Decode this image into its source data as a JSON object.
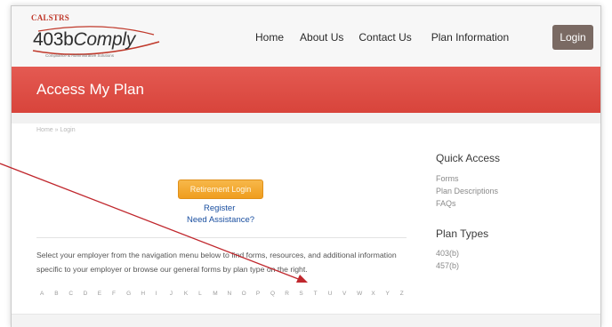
{
  "logo": {
    "top_text": "CALSTRS",
    "main_text_a": "403b",
    "main_text_b": "Comply",
    "tagline": "Compliance & Administrative Solutions"
  },
  "nav": {
    "items": [
      "Home",
      "About Us",
      "Contact Us",
      "Plan Information"
    ],
    "login_label": "Login"
  },
  "banner": {
    "title": "Access My Plan"
  },
  "breadcrumb": "Home » Login",
  "main": {
    "retirement_login_label": "Retirement Login",
    "register_label": "Register",
    "assistance_label": "Need Assistance?",
    "info_text": "Select your employer from the navigation menu below to find forms, resources, and additional information specific to your employer or browse our general forms by plan type on the right.",
    "letters": [
      "A",
      "B",
      "C",
      "D",
      "E",
      "F",
      "G",
      "H",
      "I",
      "J",
      "K",
      "L",
      "M",
      "N",
      "O",
      "P",
      "Q",
      "R",
      "S",
      "T",
      "U",
      "V",
      "W",
      "X",
      "Y",
      "Z"
    ]
  },
  "sidebar": {
    "quick_access_title": "Quick Access",
    "quick_access_links": [
      "Forms",
      "Plan Descriptions",
      "FAQs"
    ],
    "plan_types_title": "Plan Types",
    "plan_types_links": [
      "403(b)",
      "457(b)"
    ]
  },
  "colors": {
    "banner": "#dc4b42",
    "button_orange": "#f2a52c",
    "login_button": "#7a6a63",
    "link_blue": "#1a4fa0",
    "annotation_arrow": "#c0272d"
  }
}
